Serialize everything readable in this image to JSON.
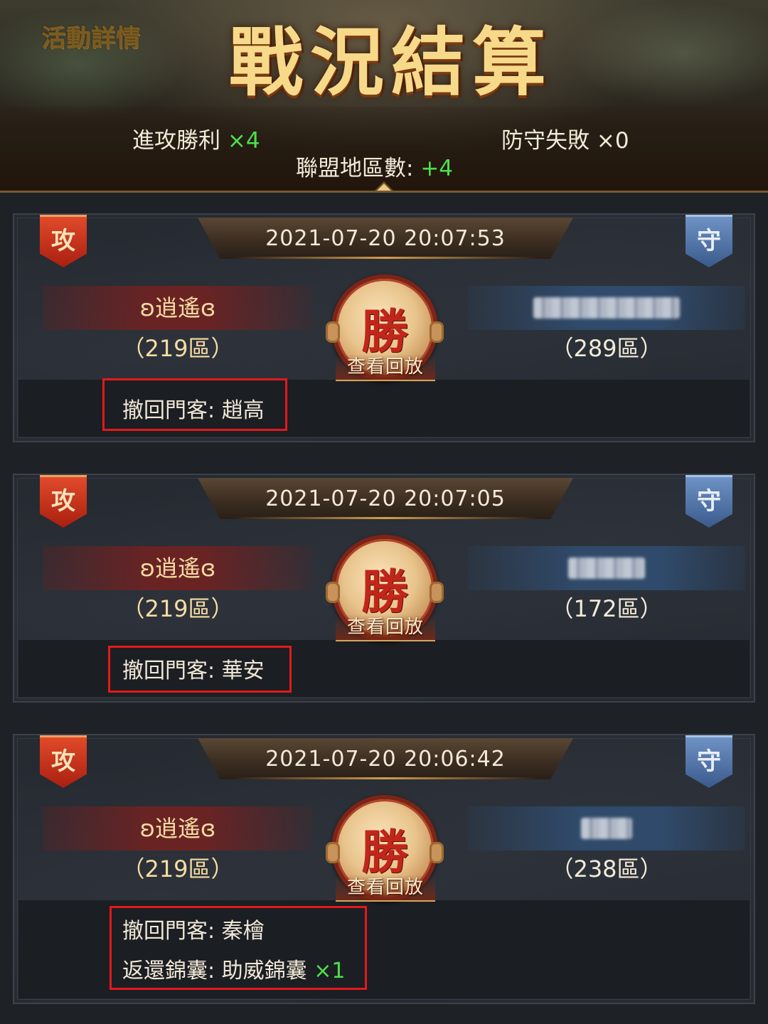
{
  "header": {
    "event_link": "活動詳情",
    "title": "戰況結算",
    "attack_win_label": "進攻勝利",
    "attack_win_count": "×4",
    "defend_fail_label": "防守失敗",
    "defend_fail_count": "×0",
    "alliance_regions_label": "聯盟地區數:",
    "alliance_regions_value": "+4"
  },
  "battles": [
    {
      "badge_attack": "攻",
      "badge_defend": "守",
      "time": "2021-07-20  20:07:53",
      "attacker_name": "ʚ逍遙ɞ",
      "attacker_zone": "（219區）",
      "defender_zone": "（289區）",
      "result": "勝",
      "replay_label": "查看回放",
      "recall_label": "撤回門客:",
      "recall_value": "趙高"
    },
    {
      "badge_attack": "攻",
      "badge_defend": "守",
      "time": "2021-07-20  20:07:05",
      "attacker_name": "ʚ逍遙ɞ",
      "attacker_zone": "（219區）",
      "defender_zone": "（172區）",
      "result": "勝",
      "replay_label": "查看回放",
      "recall_label": "撤回門客:",
      "recall_value": "華安"
    },
    {
      "badge_attack": "攻",
      "badge_defend": "守",
      "time": "2021-07-20  20:06:42",
      "attacker_name": "ʚ逍遙ɞ",
      "attacker_zone": "（219區）",
      "defender_zone": "（238區）",
      "result": "勝",
      "replay_label": "查看回放",
      "recall_label": "撤回門客:",
      "recall_value": "秦檜",
      "return_label": "返還錦囊:",
      "return_value": "助威錦囊",
      "return_count": "×1"
    }
  ]
}
